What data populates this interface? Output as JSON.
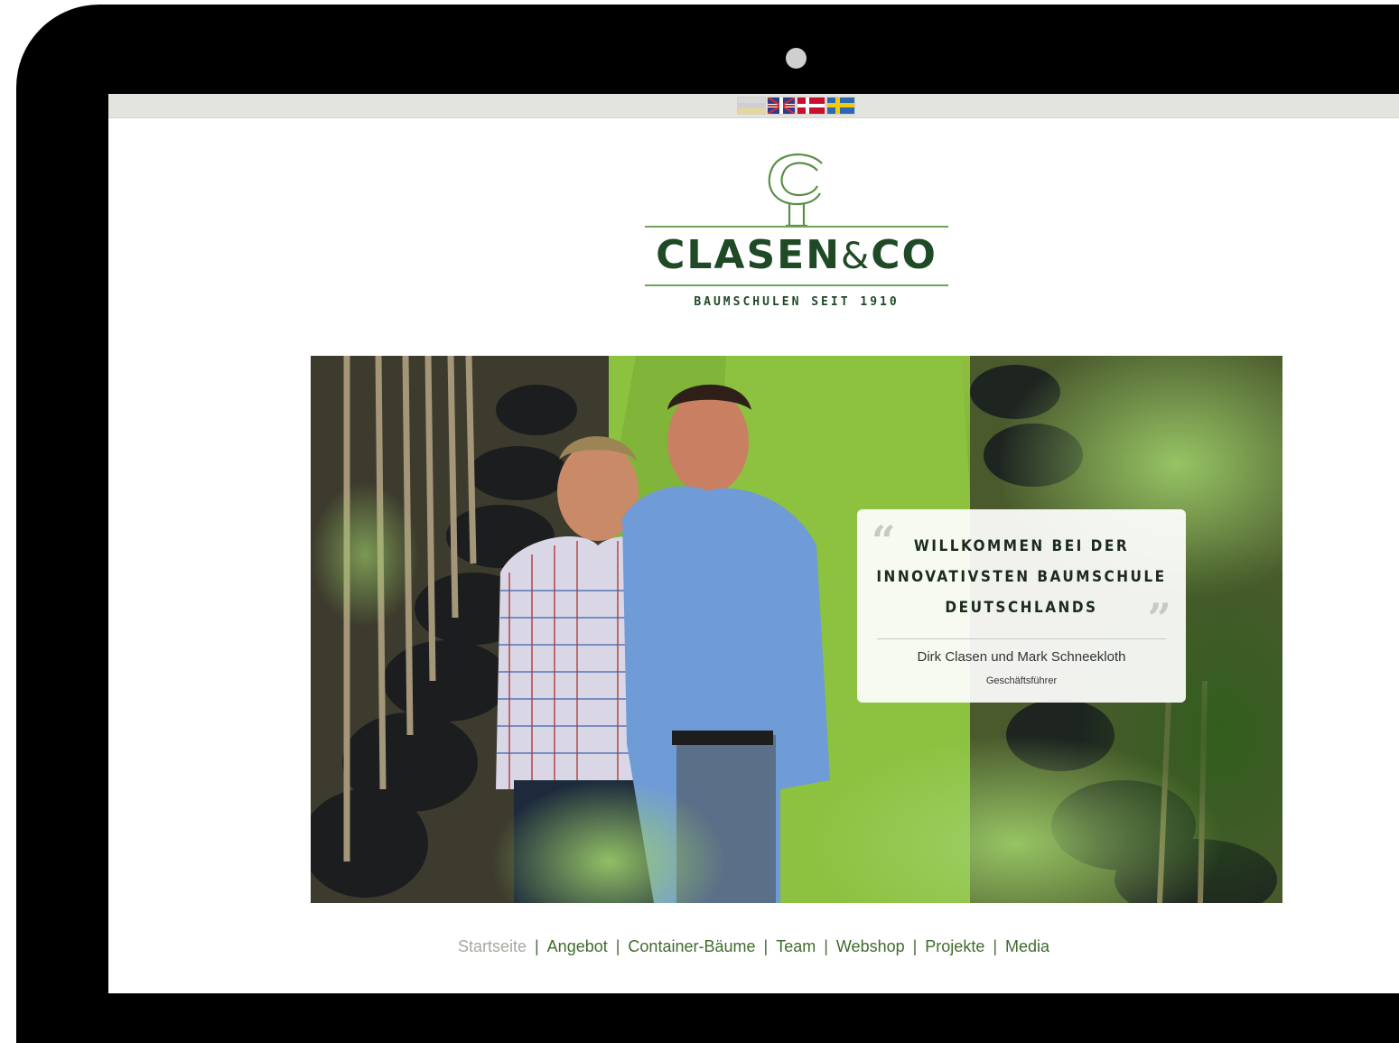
{
  "flags": [
    {
      "name": "de-flag-icon"
    },
    {
      "name": "gb-flag-icon"
    },
    {
      "name": "dk-flag-icon"
    },
    {
      "name": "se-flag-icon"
    }
  ],
  "logo": {
    "name_left": "CLASEN",
    "name_amp": "&",
    "name_right": "CO",
    "tagline": "BAUMSCHULEN SEIT 1910"
  },
  "hero": {
    "quote_line1": "WILLKOMMEN BEI DER",
    "quote_line2": "INNOVATIVSTEN BAUMSCHULE",
    "quote_line3": "DEUTSCHLANDS",
    "quote_open": "“",
    "quote_close": "”",
    "author": "Dirk Clasen und Mark Schneekloth",
    "role": "Geschäftsführer"
  },
  "nav": {
    "items": [
      {
        "label": "Startseite",
        "active": true
      },
      {
        "label": "Angebot"
      },
      {
        "label": "Container-Bäume"
      },
      {
        "label": "Team"
      },
      {
        "label": "Webshop"
      },
      {
        "label": "Projekte"
      },
      {
        "label": "Media"
      }
    ],
    "separator": "|"
  },
  "colors": {
    "brand_green": "#1f4a26",
    "accent_green": "#6fa35a",
    "nav_link": "#3f6c2c",
    "nav_active": "#a3a9a0"
  }
}
